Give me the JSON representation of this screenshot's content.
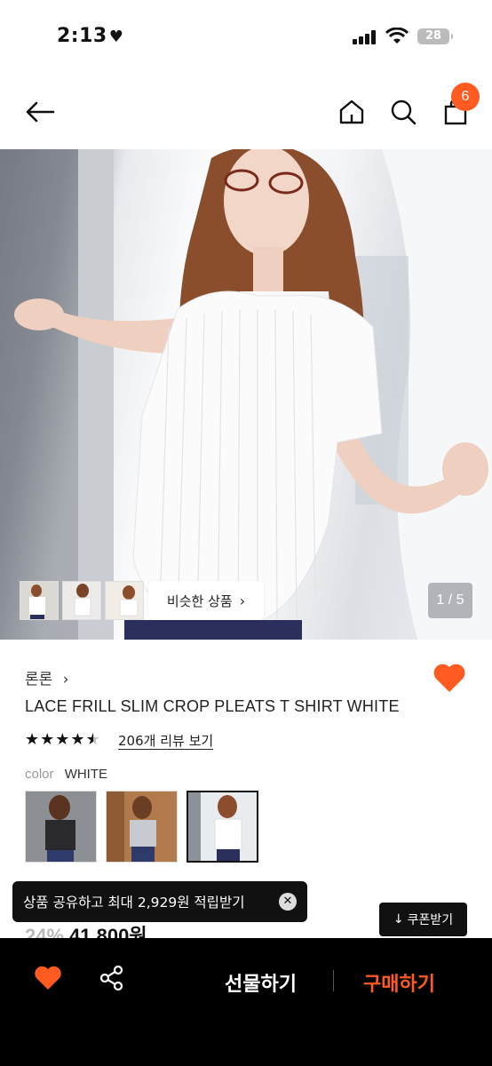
{
  "status_bar": {
    "time": "2:13",
    "battery": "28"
  },
  "nav": {
    "cart_count": "6"
  },
  "gallery": {
    "similar_label": "비슷한 상품",
    "counter": "1 / 5"
  },
  "product": {
    "brand": "론론",
    "title": "LACE FRILL SLIM CROP PLEATS T SHIRT WHITE",
    "rating": 4.5,
    "reviews_label": "206개 리뷰 보기",
    "color_label": "color",
    "color_value": "WHITE",
    "discount": "24%",
    "price": "41,800원"
  },
  "toast": {
    "text": "상품 공유하고 최대 2,929원 적립받기"
  },
  "coupon": {
    "label": "쿠폰받기"
  },
  "bottom_bar": {
    "gift_label": "선물하기",
    "buy_label": "구매하기"
  },
  "colors": {
    "accent": "#ff5a1f",
    "dark": "#000000"
  }
}
